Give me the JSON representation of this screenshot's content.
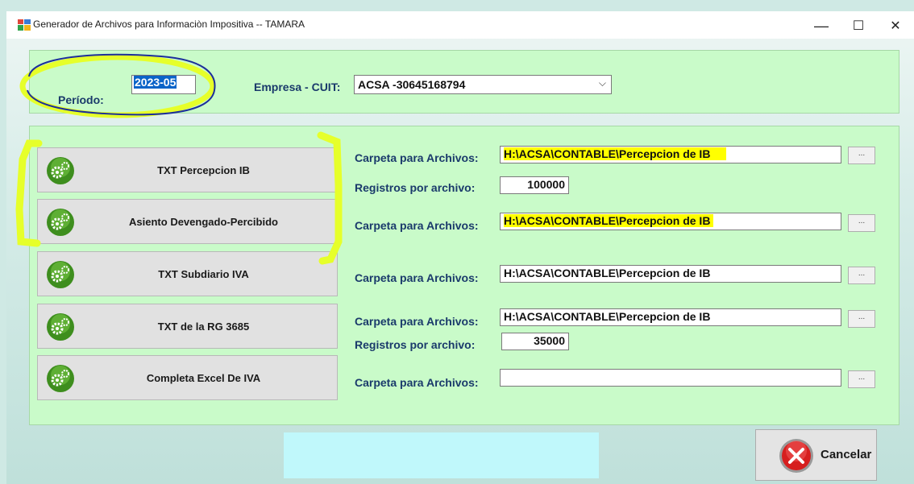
{
  "window": {
    "title": "Generador de Archivos para Informaciòn Impositiva  --  TAMARA",
    "minimize_glyph": "—",
    "maximize_glyph": "☐",
    "close_glyph": "✕"
  },
  "header": {
    "periodo_label": "Período:",
    "periodo_value": "2023-05",
    "empresa_label": "Empresa - CUIT:",
    "empresa_value": "ACSA  -30645168794",
    "empresa_dropdown_icon": "chevron-down-icon"
  },
  "actions": [
    {
      "label": "TXT Percepcion IB",
      "icon": "gears-icon"
    },
    {
      "label": "Asiento Devengado-Percibido",
      "icon": "gears-icon"
    },
    {
      "label": "TXT Subdiario IVA",
      "icon": "gears-icon"
    },
    {
      "label": "TXT de la RG 3685",
      "icon": "gears-icon"
    },
    {
      "label": "Completa Excel De IVA",
      "icon": "gears-icon"
    }
  ],
  "settings": {
    "carpeta_label": "Carpeta para Archivos:",
    "registros_label": "Registros por archivo:",
    "browse_label": "...",
    "rows": [
      {
        "carpeta": "H:\\ACSA\\CONTABLE\\Percepcion de IB",
        "registros": "100000"
      },
      {
        "carpeta": "H:\\ACSA\\CONTABLE\\Percepcion de IB"
      },
      {
        "carpeta": "H:\\ACSA\\CONTABLE\\Percepcion de IB"
      },
      {
        "carpeta": "H:\\ACSA\\CONTABLE\\Percepcion de IB",
        "registros": "35000"
      },
      {
        "carpeta": ""
      }
    ]
  },
  "footer": {
    "cancel_label": "Cancelar",
    "cancel_icon": "close-circle-icon"
  },
  "colors": {
    "panel": "#c9fbc9",
    "label_text": "#1a3a6b",
    "highlight": "#ffff00",
    "annotation": "#e6ff2a",
    "status_box": "#c0f8fb"
  }
}
